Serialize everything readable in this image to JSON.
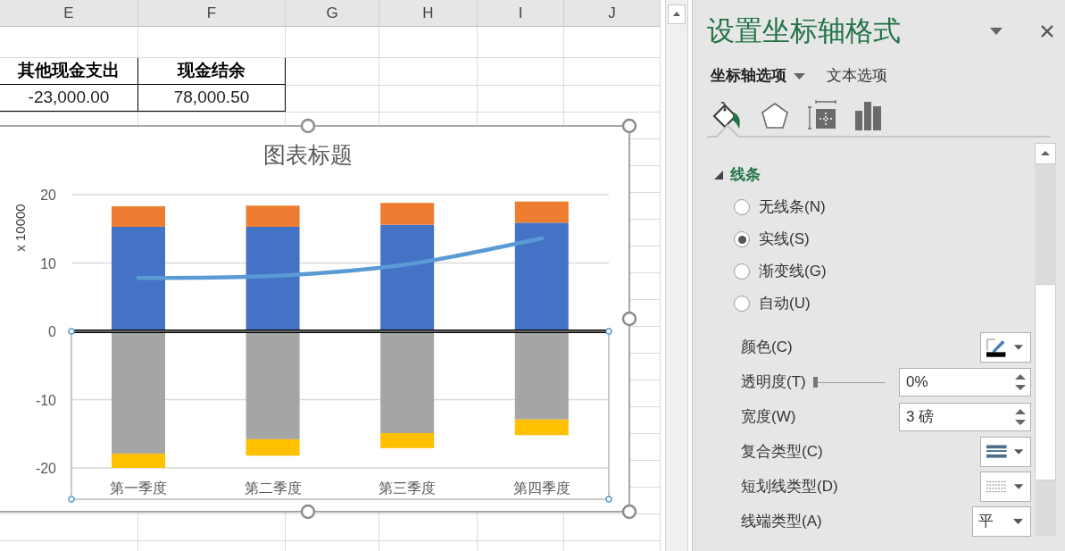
{
  "sheet": {
    "columns": [
      "E",
      "F",
      "G",
      "H",
      "I",
      "J"
    ],
    "rows": [
      {
        "kind": "header",
        "cells": [
          "其他现金支出",
          "现金结余"
        ]
      },
      {
        "kind": "data",
        "cells": [
          "-23,000.00",
          "78,000.50"
        ]
      }
    ]
  },
  "chart": {
    "axis_selected": true,
    "chart_data": {
      "type": "bar",
      "title": "图表标题",
      "ylabel": "x 10000",
      "stacked": true,
      "categories": [
        "第一季度",
        "第二季度",
        "第三季度",
        "第四季度"
      ],
      "ylim": [
        -20,
        20
      ],
      "yticks": [
        -20,
        -10,
        0,
        10,
        20
      ],
      "series": [
        {
          "type": "bar",
          "color": "#4472c4",
          "values": [
            15.3,
            15.3,
            15.6,
            15.9
          ]
        },
        {
          "type": "bar",
          "color": "#ed7d31",
          "values": [
            3.0,
            3.1,
            3.2,
            3.1
          ]
        },
        {
          "type": "bar",
          "color": "#a5a5a5",
          "values": [
            -17.9,
            -15.8,
            -14.9,
            -12.9
          ]
        },
        {
          "type": "bar",
          "color": "#ffc000",
          "values": [
            -2.1,
            -2.4,
            -2.2,
            -2.3
          ]
        },
        {
          "type": "line",
          "color": "#5b9bd5",
          "values": [
            7.8,
            8.1,
            9.8,
            13.6
          ]
        }
      ]
    }
  },
  "panel": {
    "title": "设置坐标轴格式",
    "tabs": [
      {
        "label": "坐标轴选项",
        "selected": true
      },
      {
        "label": "文本选项",
        "selected": false
      }
    ],
    "icon_tabs": [
      {
        "kind": "fill",
        "selected": true
      },
      {
        "kind": "effects",
        "selected": false
      },
      {
        "kind": "size",
        "selected": false
      },
      {
        "kind": "axis",
        "selected": false
      }
    ],
    "section": {
      "title": "线条",
      "expanded": true
    },
    "radios": [
      {
        "label": "无线条(N)",
        "selected": false
      },
      {
        "label": "实线(S)",
        "selected": true
      },
      {
        "label": "渐变线(G)",
        "selected": false
      },
      {
        "label": "自动(U)",
        "selected": false
      }
    ],
    "properties": [
      {
        "kind": "color",
        "label": "颜色(C)"
      },
      {
        "kind": "slider_spin",
        "label": "透明度(T)",
        "level": 0,
        "value": "0%"
      },
      {
        "kind": "spin",
        "label": "宽度(W)",
        "value": "3 磅"
      },
      {
        "kind": "compound",
        "label": "复合类型(C)"
      },
      {
        "kind": "dash",
        "label": "短划线类型(D)"
      },
      {
        "kind": "dropdown",
        "label": "线端类型(A)",
        "value": "平"
      }
    ]
  }
}
